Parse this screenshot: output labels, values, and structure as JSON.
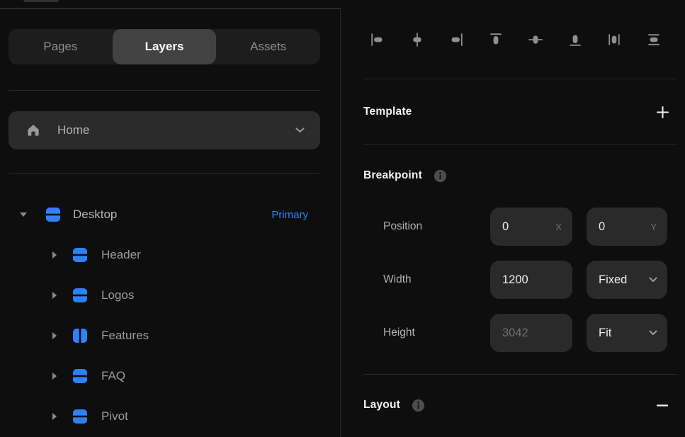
{
  "colors": {
    "accent": "#2f81f7",
    "panel_bg": "#0e0e0e",
    "field_bg": "#2a2a2a",
    "active_tab_bg": "#424242"
  },
  "left_panel": {
    "tabs": [
      {
        "label": "Pages",
        "active": false
      },
      {
        "label": "Layers",
        "active": true
      },
      {
        "label": "Assets",
        "active": false
      }
    ],
    "page_selector": {
      "label": "Home",
      "icon": "home-icon",
      "chevron": "chevron-down-icon"
    },
    "layers": [
      {
        "label": "Desktop",
        "badge": "Primary",
        "icon": "stack-rows-icon",
        "level": 0,
        "expanded": true
      },
      {
        "label": "Header",
        "icon": "stack-rows-icon",
        "level": 1
      },
      {
        "label": "Logos",
        "icon": "stack-rows-icon",
        "level": 1
      },
      {
        "label": "Features",
        "icon": "stack-columns-icon",
        "level": 1
      },
      {
        "label": "FAQ",
        "icon": "stack-rows-icon",
        "level": 1
      },
      {
        "label": "Pivot",
        "icon": "stack-rows-icon",
        "level": 1
      }
    ]
  },
  "right_panel": {
    "align_toolbar": [
      "align-left",
      "align-center-horizontal",
      "align-right",
      "align-top",
      "align-center-vertical",
      "align-bottom",
      "distribute-horizontal",
      "distribute-vertical"
    ],
    "template": {
      "title": "Template"
    },
    "breakpoint": {
      "title": "Breakpoint",
      "position": {
        "label": "Position",
        "x_value": "0",
        "x_suffix": "X",
        "y_value": "0",
        "y_suffix": "Y"
      },
      "width": {
        "label": "Width",
        "value": "1200",
        "mode": "Fixed"
      },
      "height": {
        "label": "Height",
        "value": "3042",
        "mode": "Fit"
      }
    },
    "layout": {
      "title": "Layout"
    }
  }
}
